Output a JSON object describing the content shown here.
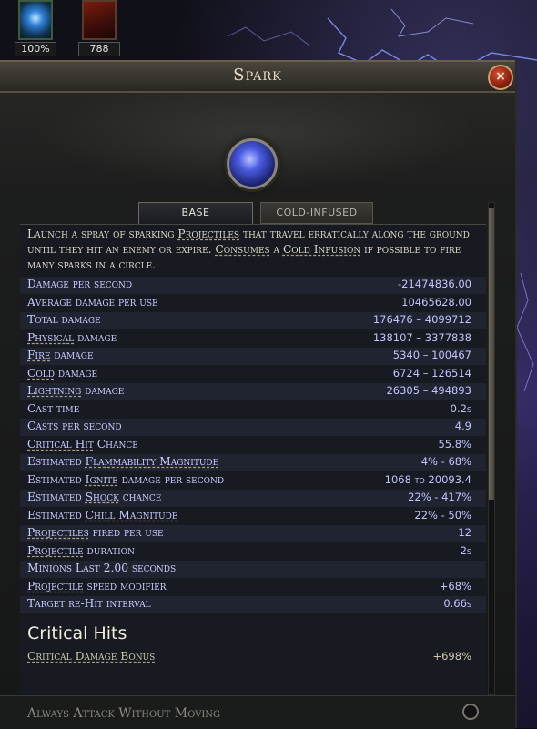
{
  "buffs": [
    {
      "icon": "lightning-orb-icon",
      "value": "100%"
    },
    {
      "icon": "fire-demon-icon",
      "value": "788"
    }
  ],
  "window": {
    "title": "Spark",
    "close_icon": "×"
  },
  "skill_icon": "spark-orb-icon",
  "tabs": [
    {
      "label": "BASE",
      "active": true
    },
    {
      "label": "COLD-INFUSED",
      "active": false
    }
  ],
  "description": {
    "parts": [
      "Launch a spray of sparking ",
      "Projectiles",
      " that travel erratically along the ground until they hit an enemy or expire. ",
      "Consumes",
      " a ",
      "Cold Infusion",
      " if possible to fire many sparks in a circle."
    ]
  },
  "stats": [
    {
      "label": "Damage per second",
      "value": "-21474836.00"
    },
    {
      "label": "Average damage per use",
      "value": "10465628.00"
    },
    {
      "label": "Total damage",
      "value": "176476 – 4099712"
    },
    {
      "label": "Physical damage",
      "value": "138107 – 3377838"
    },
    {
      "label": "Fire damage",
      "value": "5340 – 100467"
    },
    {
      "label": "Cold damage",
      "value": "6724 – 126514"
    },
    {
      "label": "Lightning damage",
      "value": "26305 – 494893"
    },
    {
      "label": "Cast time",
      "value": "0.2s"
    },
    {
      "label": "Casts per second",
      "value": "4.9"
    },
    {
      "label": "Critical Hit Chance",
      "value": "55.8%"
    },
    {
      "label": "Estimated Flammability Magnitude",
      "value": "4% - 68%"
    },
    {
      "label": "Estimated Ignite damage per second",
      "value": "1068 to 20093.4"
    },
    {
      "label": "Estimated Shock chance",
      "value": "22% - 417%"
    },
    {
      "label": "Estimated Chill Magnitude",
      "value": "22% - 50%"
    },
    {
      "label": "Projectiles fired per use",
      "value": "12"
    },
    {
      "label": "Projectile duration",
      "value": "2s"
    },
    {
      "label": "Minions Last 2.00 seconds",
      "value": ""
    },
    {
      "label": "Projectile speed modifier",
      "value": "+68%"
    },
    {
      "label": "Target re-Hit interval",
      "value": "0.66s"
    }
  ],
  "critical_section": {
    "title": "Critical Hits",
    "rows": [
      {
        "label": "Critical Damage Bonus",
        "value": "+698%"
      }
    ]
  },
  "footer": {
    "label": "Always Attack Without Moving"
  },
  "colors": {
    "stat_label": "#c9ccff",
    "stat_value": "#bfc4ff",
    "close_button": "#8a1f12",
    "accent_gold": "#c9a46a"
  }
}
